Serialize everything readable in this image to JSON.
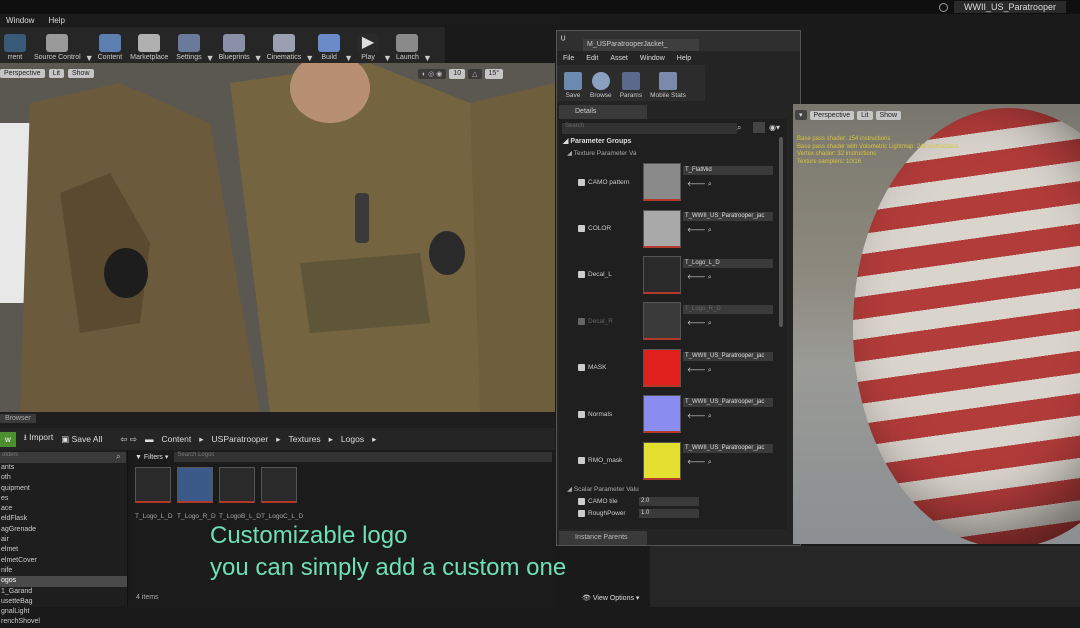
{
  "window": {
    "menu": [
      "Window",
      "Help"
    ],
    "project": "WWII_US_Paratrooper"
  },
  "toolbar": {
    "items": [
      "rrent",
      "Source Control",
      "Content",
      "Marketplace",
      "Settings",
      "Blueprints",
      "Cinematics",
      "Build",
      "Play",
      "Launch"
    ]
  },
  "viewport": {
    "perspective": "Perspective",
    "lit": "Lit",
    "show": "Show",
    "snap": "10",
    "angle": "15°"
  },
  "content_browser": {
    "tab": "Browser",
    "add": "w",
    "import": "Import",
    "save_all": "Save All",
    "breadcrumb": [
      "Content",
      "USParatrooper",
      "Textures",
      "Logos"
    ],
    "folder_search": "olders",
    "folders": [
      "ants",
      "oth",
      "quipment",
      "es",
      "ace",
      "eldFlask",
      "agGrenade",
      "air",
      "elmet",
      "elmetCover",
      "nife",
      "ogos",
      "1_Garand",
      "usetteBag",
      "gnalLight",
      "renchShovel"
    ],
    "selected_folder": "ogos",
    "filters": "Filters",
    "asset_search": "Search Logos",
    "assets": [
      "T_Logo_L_D",
      "T_Logo_R_D",
      "T_LogoB_L_D",
      "T_LogoC_L_D"
    ],
    "item_count": "4 items",
    "view_options": "View Options"
  },
  "caption": {
    "line1": "Customizable logo",
    "line2": "you can simply add a custom one"
  },
  "material": {
    "tab": "M_USParatrooperJacket_",
    "menu": [
      "File",
      "Edit",
      "Asset",
      "Window",
      "Help"
    ],
    "tools": [
      "Save",
      "Browse",
      "Params",
      "Mobile Stats"
    ],
    "details_tab": "Details",
    "search": "Search",
    "param_groups": "Parameter Groups",
    "texture_group": "Texture Parameter Va",
    "params": [
      {
        "name": "CAMO pattern",
        "texture": "T_FlatMid",
        "color": "#8a8a8a",
        "enabled": true
      },
      {
        "name": "COLOR",
        "texture": "T_WWII_US_Paratrooper_jac",
        "color": "#a9a9a9",
        "enabled": true
      },
      {
        "name": "Decal_L",
        "texture": "T_Logo_L_D",
        "color": "#2a2a2a",
        "enabled": true
      },
      {
        "name": "Decal_R",
        "texture": "T_Logo_R_D",
        "color": "#3a3a3a",
        "enabled": false
      },
      {
        "name": "MASK",
        "texture": "T_WWII_US_Paratrooper_jac",
        "color": "#e0201a",
        "enabled": true
      },
      {
        "name": "Normals",
        "texture": "T_WWII_US_Paratrooper_jac",
        "color": "#8a8cf0",
        "enabled": true
      },
      {
        "name": "RMO_mask",
        "texture": "T_WWII_US_Paratrooper_jac",
        "color": "#e4e030",
        "enabled": true
      }
    ],
    "scalar_group": "Scalar Parameter Valu",
    "scalars": [
      {
        "name": "CAMO tile",
        "value": "2.0"
      },
      {
        "name": "RoughPower",
        "value": "1.0"
      }
    ],
    "instance_parents": "Instance Parents"
  },
  "preview": {
    "perspective": "Perspective",
    "lit": "Lit",
    "show": "Show",
    "stats": [
      "Base pass shader: 154 instructions",
      "Base pass shader with Volumetric Lightmap: 242 instructions",
      "Vertex shader: 32 instructions",
      "Texture samplers: 10/16"
    ]
  }
}
